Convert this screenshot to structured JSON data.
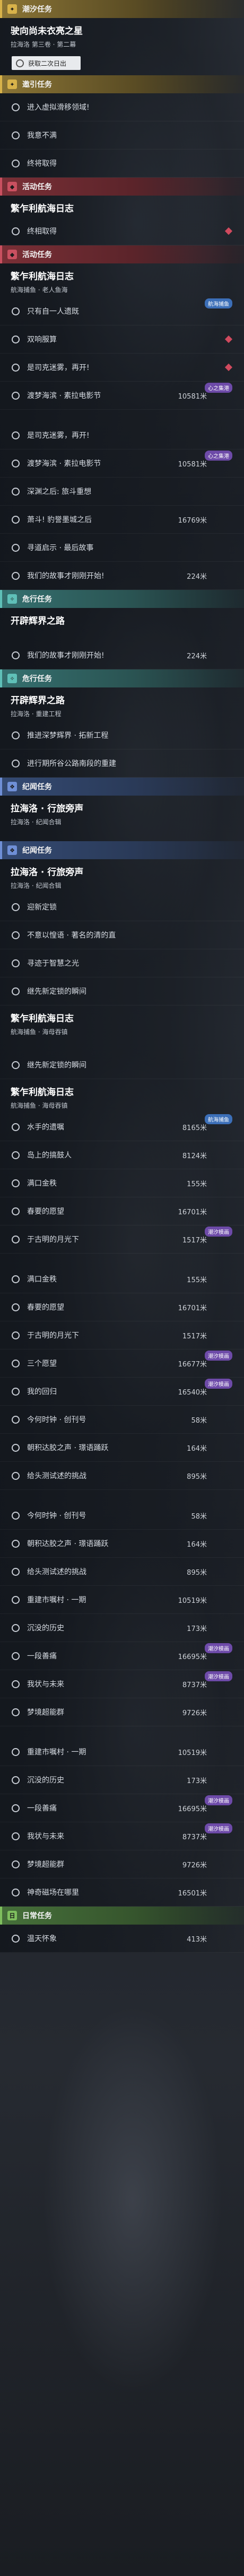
{
  "sections": [
    {
      "kind": "hdr",
      "color": "gold",
      "icon": "✦",
      "label": "潮汐任务"
    },
    {
      "kind": "title",
      "t": "驶向尚未衣亮之星",
      "s": "拉海洛 第三卷 · 第二幕"
    },
    {
      "kind": "chip",
      "label": "获取二次日出"
    },
    {
      "kind": "hdr",
      "color": "gold",
      "icon": "✦",
      "label": "邀引任务"
    },
    {
      "kind": "item",
      "label": "进入虚拟滑移领域!"
    },
    {
      "kind": "item",
      "label": "我意不满"
    },
    {
      "kind": "item",
      "label": "终将取得"
    },
    {
      "kind": "hdr",
      "color": "red",
      "icon": "◆",
      "label": "活动任务"
    },
    {
      "kind": "title",
      "t": "繁乍利航海日志",
      "s": ""
    },
    {
      "kind": "item",
      "label": "终相取得",
      "dia": true
    },
    {
      "kind": "hdr",
      "color": "red",
      "icon": "◆",
      "label": "活动任务"
    },
    {
      "kind": "title",
      "t": "繁乍利航海日志",
      "s": "航海捕鱼 · 老人鱼海"
    },
    {
      "kind": "item",
      "label": "只有自一人遗既",
      "tag2": "航海捕鱼"
    },
    {
      "kind": "item",
      "label": "双响服算",
      "dia": true
    },
    {
      "kind": "item",
      "label": "是司克迷雾，再开!",
      "dia": true
    },
    {
      "kind": "item",
      "label": "渡梦海滨 · 素拉电影节",
      "tag": "心之集港",
      "dist": "10581米"
    },
    {
      "kind": "spacer"
    },
    {
      "kind": "item",
      "label": "是司克迷雾，再开!"
    },
    {
      "kind": "item",
      "label": "渡梦海滨 · 素拉电影节",
      "tag": "心之集港",
      "dist": "10581米"
    },
    {
      "kind": "item",
      "label": "深渊之后: 旅斗重想"
    },
    {
      "kind": "item",
      "label": "萧斗! 豹誉墨城之后",
      "dist": "16769米"
    },
    {
      "kind": "item",
      "label": "寻道启示 · 最后故事"
    },
    {
      "kind": "item",
      "label": "我们的故事才刚刚开始!",
      "dist": "224米"
    },
    {
      "kind": "hdr",
      "color": "teal",
      "icon": "✧",
      "label": "危行任务"
    },
    {
      "kind": "title",
      "t": "开辟辉界之路",
      "s": ""
    },
    {
      "kind": "spacer"
    },
    {
      "kind": "item",
      "label": "我们的故事才刚刚开始!",
      "dist": "224米"
    },
    {
      "kind": "hdr",
      "color": "teal",
      "icon": "✧",
      "label": "危行任务"
    },
    {
      "kind": "title",
      "t": "开辟辉界之路",
      "s": "拉海洛 · 重建工程"
    },
    {
      "kind": "item",
      "label": "推进深梦辉界 · 拓新工程"
    },
    {
      "kind": "item",
      "label": "进行期所谷公路南段的重建"
    },
    {
      "kind": "hdr",
      "color": "blue",
      "icon": "❖",
      "label": "纪闻任务"
    },
    {
      "kind": "title",
      "t": "拉海洛 · 行旅旁声",
      "s": "拉海洛 · 纪闻合辑"
    },
    {
      "kind": "spacer"
    },
    {
      "kind": "hdr",
      "color": "blue",
      "icon": "❖",
      "label": "纪闻任务"
    },
    {
      "kind": "title",
      "t": "拉海洛 · 行旅旁声",
      "s": "拉海洛 · 纪闻合辑"
    },
    {
      "kind": "item",
      "label": "迎新定锁"
    },
    {
      "kind": "item",
      "label": "不意以惶语 · 著名的清的直"
    },
    {
      "kind": "item",
      "label": "寻迹于智慧之光"
    },
    {
      "kind": "item",
      "label": "继先新定锁的瞬间"
    },
    {
      "kind": "title",
      "t": "繁乍利航海日志",
      "s": "航海捕鱼 · 海母吞镇"
    },
    {
      "kind": "spacer"
    },
    {
      "kind": "item",
      "label": "继先新定锁的瞬间"
    },
    {
      "kind": "title",
      "t": "繁乍利航海日志",
      "s": "航海捕鱼 · 海母吞镇"
    },
    {
      "kind": "item",
      "label": "水手的遗嘱",
      "tag2": "航海捕鱼",
      "dist": "8165米"
    },
    {
      "kind": "item",
      "label": "岛上的搞鼓人",
      "dist": "8124米"
    },
    {
      "kind": "item",
      "label": "满口金秩",
      "dist": "155米"
    },
    {
      "kind": "item",
      "label": "春要的愿望",
      "dist": "16701米"
    },
    {
      "kind": "item",
      "label": "于古明的月光下",
      "tag": "潮汐模画",
      "dist": "1517米"
    },
    {
      "kind": "spacer"
    },
    {
      "kind": "item",
      "label": "满口金秩",
      "dist": "155米"
    },
    {
      "kind": "item",
      "label": "春要的愿望",
      "dist": "16701米"
    },
    {
      "kind": "item",
      "label": "于古明的月光下",
      "dist": "1517米"
    },
    {
      "kind": "item",
      "label": "三个愿望",
      "tag": "潮汐模画",
      "dist": "16677米"
    },
    {
      "kind": "item",
      "label": "我的回归",
      "tag": "潮汐模画",
      "dist": "16540米"
    },
    {
      "kind": "item",
      "label": "今何时钟 · 创刊号",
      "dist": "58米"
    },
    {
      "kind": "item",
      "label": "朝积达胶之声 · 璟语踊跃",
      "dist": "164米"
    },
    {
      "kind": "item",
      "label": "给头测试述的挑战",
      "dist": "895米"
    },
    {
      "kind": "spacer"
    },
    {
      "kind": "item",
      "label": "今何时钟 · 创刊号",
      "dist": "58米"
    },
    {
      "kind": "item",
      "label": "朝积达胶之声 · 璟语踊跃",
      "dist": "164米"
    },
    {
      "kind": "item",
      "label": "给头测试述的挑战",
      "dist": "895米"
    },
    {
      "kind": "item",
      "label": "重建市嘱村 · 一期",
      "dist": "10519米"
    },
    {
      "kind": "item",
      "label": "沉没的历史",
      "dist": "173米"
    },
    {
      "kind": "item",
      "label": "一段善痛",
      "tag": "潮汐模画",
      "dist": "16695米"
    },
    {
      "kind": "item",
      "label": "我状与未来",
      "tag": "潮汐模画",
      "dist": "8737米"
    },
    {
      "kind": "item",
      "label": "梦境超能群",
      "dist": "9726米"
    },
    {
      "kind": "spacer"
    },
    {
      "kind": "item",
      "label": "重建市嘱村 · 一期",
      "dist": "10519米"
    },
    {
      "kind": "item",
      "label": "沉没的历史",
      "dist": "173米"
    },
    {
      "kind": "item",
      "label": "一段善痛",
      "tag": "潮汐模画",
      "dist": "16695米"
    },
    {
      "kind": "item",
      "label": "我状与未来",
      "tag": "潮汐模画",
      "dist": "8737米"
    },
    {
      "kind": "item",
      "label": "梦境超能群",
      "dist": "9726米"
    },
    {
      "kind": "item",
      "label": "神奇磁场在哪里",
      "dist": "16501米"
    },
    {
      "kind": "hdr",
      "color": "green",
      "icon": "日",
      "label": "日常任务"
    },
    {
      "kind": "item",
      "label": "温天怀象",
      "dist": "413米"
    }
  ]
}
